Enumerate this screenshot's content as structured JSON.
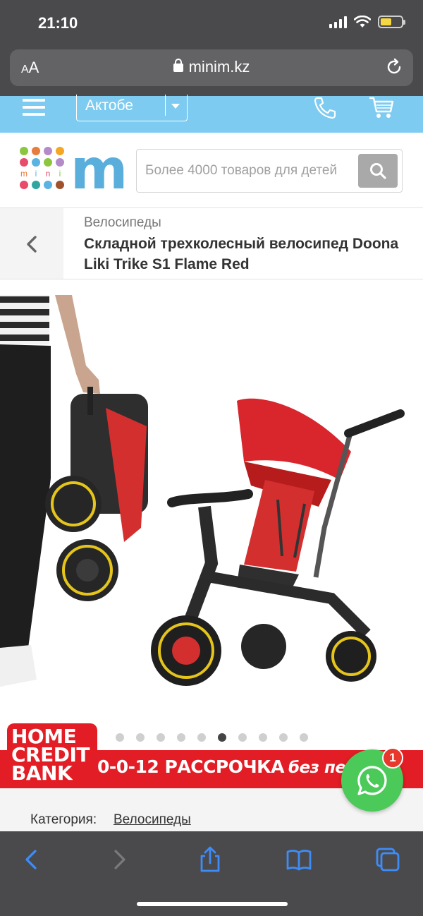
{
  "status_bar": {
    "time": "21:10"
  },
  "browser": {
    "aa_small": "A",
    "aa_large": "A",
    "domain": "minim.kz"
  },
  "header": {
    "city": "Актобе"
  },
  "logo": {
    "small_text": "mini",
    "big_letter": "m"
  },
  "search": {
    "placeholder": "Более 4000 товаров для детей"
  },
  "breadcrumb": {
    "category": "Велосипеды",
    "title": "Складной трехколесный велосипед Doona Liki Trike S1 Flame Red"
  },
  "gallery": {
    "slide_count": 10,
    "active_index": 5
  },
  "promo": {
    "brand_line1": "HOME",
    "brand_line2": "CREDIT",
    "brand_line3": "BANK",
    "text": "0-0-12 РАССРОЧКА",
    "sub": "без пере...ы"
  },
  "whatsapp": {
    "badge": "1"
  },
  "category": {
    "label": "Категория:",
    "link": "Велосипеды"
  },
  "colors": {
    "nav_blue": "#7dcbf0",
    "brand_blue": "#5aaedc",
    "promo_red": "#e31d25",
    "whatsapp_green": "#4bca5a",
    "ios_link_blue": "#3e8cf7"
  }
}
